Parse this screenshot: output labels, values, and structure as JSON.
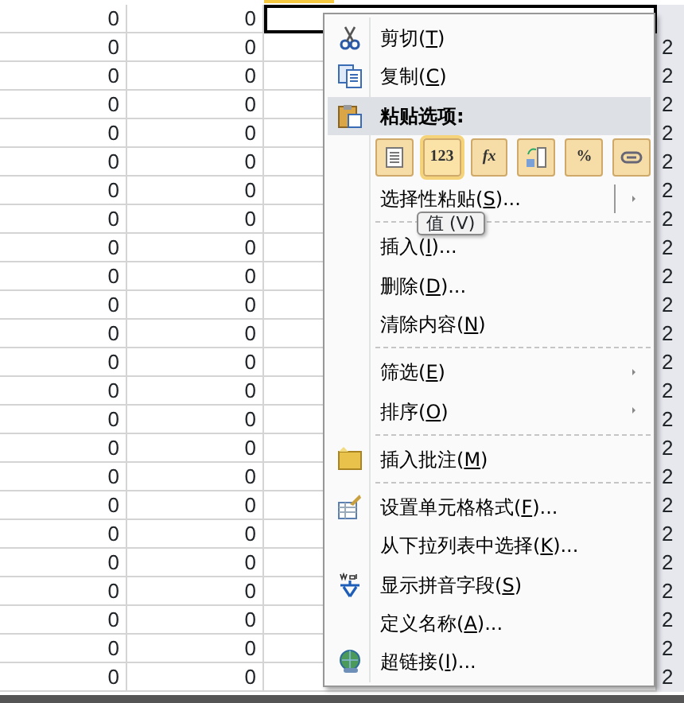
{
  "sheet": {
    "rows": [
      {
        "cells": [
          "0",
          "0"
        ],
        "selected": true
      },
      {
        "cells": [
          "0",
          "0"
        ],
        "edge": "2",
        "selected": false
      },
      {
        "cells": [
          "0",
          "0"
        ],
        "edge": "2",
        "selected": false
      },
      {
        "cells": [
          "0",
          "0"
        ],
        "edge": "2",
        "selected": false
      },
      {
        "cells": [
          "0",
          "0"
        ],
        "edge": "2",
        "selected": false
      },
      {
        "cells": [
          "0",
          "0"
        ],
        "edge": "2",
        "selected": false
      },
      {
        "cells": [
          "0",
          "0"
        ],
        "edge": "2",
        "selected": false
      },
      {
        "cells": [
          "0",
          "0"
        ],
        "edge": "2",
        "selected": false
      },
      {
        "cells": [
          "0",
          "0"
        ],
        "edge": "2",
        "selected": false
      },
      {
        "cells": [
          "0",
          "0"
        ],
        "edge": "2",
        "selected": false
      },
      {
        "cells": [
          "0",
          "0"
        ],
        "edge": "2",
        "selected": false
      },
      {
        "cells": [
          "0",
          "0"
        ],
        "edge": "2",
        "selected": false
      },
      {
        "cells": [
          "0",
          "0"
        ],
        "edge": "2",
        "selected": false
      },
      {
        "cells": [
          "0",
          "0"
        ],
        "edge": "2",
        "selected": false
      },
      {
        "cells": [
          "0",
          "0"
        ],
        "edge": "2",
        "selected": false
      },
      {
        "cells": [
          "0",
          "0"
        ],
        "edge": "2",
        "selected": false
      },
      {
        "cells": [
          "0",
          "0"
        ],
        "edge": "2",
        "selected": false
      },
      {
        "cells": [
          "0",
          "0"
        ],
        "edge": "2",
        "selected": false
      },
      {
        "cells": [
          "0",
          "0"
        ],
        "edge": "2",
        "selected": false
      },
      {
        "cells": [
          "0",
          "0"
        ],
        "edge": "2",
        "selected": false
      },
      {
        "cells": [
          "0",
          "0"
        ],
        "edge": "2",
        "selected": false
      },
      {
        "cells": [
          "0",
          "0"
        ],
        "edge": "2",
        "selected": false
      },
      {
        "cells": [
          "0",
          "0"
        ],
        "edge": "2",
        "selected": false
      },
      {
        "cells": [
          "0",
          "0"
        ],
        "edge": "2",
        "selected": false
      }
    ]
  },
  "context_menu": {
    "items": [
      {
        "kind": "item",
        "before": "剪切(",
        "key": "T",
        "after": ")"
      },
      {
        "kind": "item",
        "before": "复制(",
        "key": "C",
        "after": ")"
      },
      {
        "kind": "header",
        "text": "粘贴选项:"
      },
      {
        "kind": "paste_options",
        "options": [
          {
            "selected": false
          },
          {
            "text": "123",
            "selected": true
          },
          {
            "text": "fx",
            "selected": false
          },
          {
            "selected": false
          },
          {
            "text": "%",
            "selected": false
          },
          {
            "selected": false
          }
        ]
      },
      {
        "kind": "item",
        "before": "选择性粘贴(",
        "key": "S",
        "after": ")...",
        "submenu": true
      },
      {
        "kind": "separator"
      },
      {
        "kind": "item",
        "before": "插入(",
        "key": "I",
        "after": ")..."
      },
      {
        "kind": "item",
        "before": "删除(",
        "key": "D",
        "after": ")..."
      },
      {
        "kind": "item",
        "before": "清除内容(",
        "key": "N",
        "after": ")"
      },
      {
        "kind": "separator"
      },
      {
        "kind": "item",
        "before": "筛选(",
        "key": "E",
        "after": ")",
        "submenu": true
      },
      {
        "kind": "item",
        "before": "排序(",
        "key": "O",
        "after": ")",
        "submenu": true
      },
      {
        "kind": "separator"
      },
      {
        "kind": "item",
        "before": "插入批注(",
        "key": "M",
        "after": ")"
      },
      {
        "kind": "separator"
      },
      {
        "kind": "item",
        "before": "设置单元格格式(",
        "key": "F",
        "after": ")..."
      },
      {
        "kind": "item",
        "before": "从下拉列表中选择(",
        "key": "K",
        "after": ")..."
      },
      {
        "kind": "item",
        "before": "显示拼音字段(",
        "key": "S",
        "after": ")"
      },
      {
        "kind": "item",
        "before": "定义名称(",
        "key": "A",
        "after": ")..."
      },
      {
        "kind": "item",
        "before": "超链接(",
        "key": "I",
        "after": ")..."
      }
    ]
  },
  "tooltip": {
    "text": "值 (V)"
  }
}
